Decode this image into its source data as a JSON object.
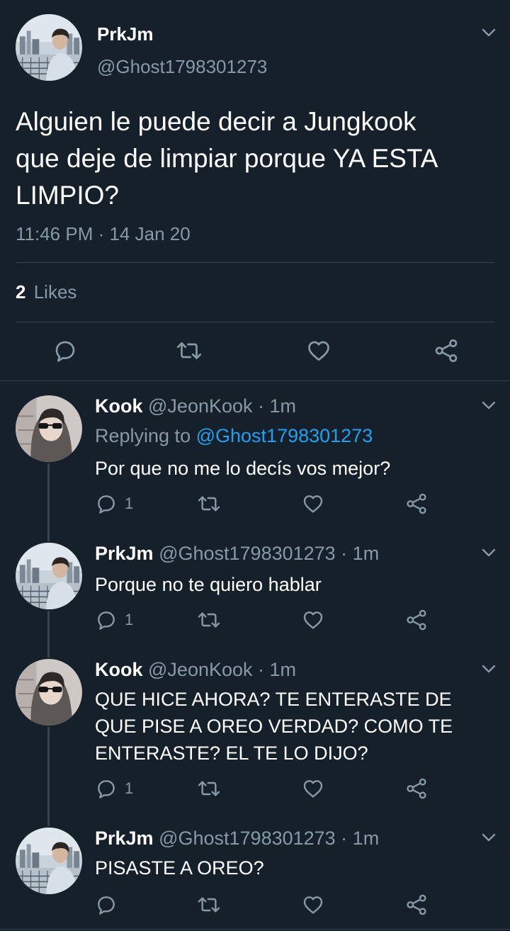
{
  "main": {
    "display_name": "PrkJm",
    "handle": "@Ghost1798301273",
    "text_lines": [
      "Alguien le puede decir a Jungkook",
      "que deje de limpiar porque YA ESTA",
      "LIMPIO?"
    ],
    "timestamp": "11:46 PM · 14 Jan 20",
    "likes_count": "2",
    "likes_label": "Likes"
  },
  "replies": [
    {
      "name": "Kook",
      "meta": "@JeonKook · 1m",
      "replying_prefix": "Replying to",
      "replying_handle": "@Ghost1798301273",
      "lines": [
        "Por que no me lo decís vos mejor?"
      ],
      "reply_count": "1"
    },
    {
      "name": "PrkJm",
      "meta": "@Ghost1798301273 · 1m",
      "lines": [
        "Porque no te quiero hablar"
      ],
      "reply_count": "1"
    },
    {
      "name": "Kook",
      "meta": "@JeonKook · 1m",
      "lines": [
        "QUE HICE AHORA? TE ENTERASTE DE",
        "QUE PISE A OREO VERDAD? COMO TE",
        "ENTERASTE? EL TE LO DIJO?"
      ],
      "reply_count": "1"
    },
    {
      "name": "PrkJm",
      "meta": "@Ghost1798301273 · 1m",
      "lines": [
        "PISASTE A OREO?"
      ],
      "reply_count": ""
    }
  ],
  "colors": {
    "background": "#15202b",
    "muted": "#8899a6",
    "link": "#1da1f2",
    "divider": "#38444d"
  }
}
